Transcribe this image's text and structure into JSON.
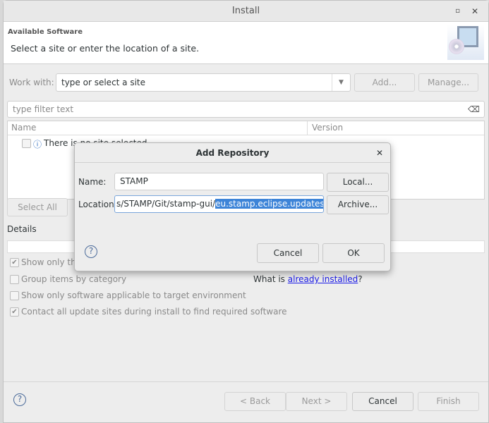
{
  "window": {
    "title": "Install"
  },
  "header": {
    "title": "Available Software",
    "subtitle": "Select a site or enter the location of a site."
  },
  "work_with": {
    "label": "Work with:",
    "value": "type or select a site",
    "add": "Add...",
    "manage": "Manage..."
  },
  "filter": {
    "placeholder": "type filter text"
  },
  "table": {
    "columns": [
      "Name",
      "Version"
    ],
    "rows": [
      {
        "name": "There is no site selected",
        "checked": false
      }
    ]
  },
  "buttons": {
    "select_all": "Select All"
  },
  "details": {
    "label": "Details"
  },
  "options": [
    {
      "label": "Show only the",
      "checked": true
    },
    {
      "label": "Group items by category",
      "checked": false
    },
    {
      "label": "Show only software applicable to target environment",
      "checked": false
    },
    {
      "label": "Contact all update sites during install to find required software",
      "checked": true
    }
  ],
  "installed": {
    "prefix": "What is ",
    "link": "already installed",
    "suffix": "?"
  },
  "footer": {
    "back": "< Back",
    "next": "Next >",
    "cancel": "Cancel",
    "finish": "Finish"
  },
  "dialog": {
    "title": "Add Repository",
    "name_label": "Name:",
    "name_value": "STAMP",
    "location_label": "Location:",
    "location_plain": "s/STAMP/Git/stamp-gui/",
    "location_selected": "eu.stamp.eclipse.updatesite/",
    "local": "Local...",
    "archive": "Archive...",
    "cancel": "Cancel",
    "ok": "OK"
  },
  "colors": {
    "selection": "#3d84d8",
    "link": "#1a1ae6"
  }
}
